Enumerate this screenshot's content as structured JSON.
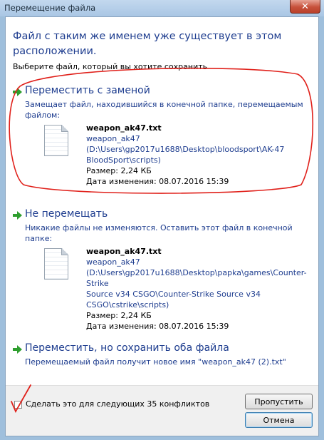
{
  "window": {
    "title": "Перемещение файла"
  },
  "heading": "Файл с таким же именем уже существует в этом расположении.",
  "subtitle": "Выберите файл, который вы хотите сохранить",
  "options": [
    {
      "title": "Переместить с заменой",
      "description": "Замещает файл, находившийся в конечной папке, перемещаемым файлом:",
      "file": {
        "name": "weapon_ak47.txt",
        "path_lines": [
          "weapon_ak47",
          "(D:\\Users\\gp2017u1688\\Desktop\\bloodsport\\AK-47",
          "BloodSport\\scripts)"
        ],
        "size": "Размер: 2,24 КБ",
        "modified": "Дата изменения: 08.07.2016 15:39"
      }
    },
    {
      "title": "Не перемещать",
      "description": "Никакие файлы не изменяются. Оставить этот файл в конечной папке:",
      "file": {
        "name": "weapon_ak47.txt",
        "path_lines": [
          "weapon_ak47",
          "(D:\\Users\\gp2017u1688\\Desktop\\papka\\games\\Counter-Strike",
          "Source v34 CSGO\\Counter-Strike Source v34",
          "CSGO\\cstrike\\scripts)"
        ],
        "size": "Размер: 2,24 КБ",
        "modified": "Дата изменения: 08.07.2016 15:39"
      }
    },
    {
      "title": "Переместить, но сохранить оба файла",
      "description": "Перемещаемый файл получит новое имя \"weapon_ak47 (2).txt\""
    }
  ],
  "checkbox": {
    "label": "Сделать это для следующих 35 конфликтов",
    "checked": false
  },
  "buttons": {
    "skip": "Пропустить",
    "cancel": "Отмена"
  },
  "icons": {
    "option_arrow": "green-arrow-icon",
    "close": "close-icon",
    "file": "text-file-icon"
  },
  "colors": {
    "link_blue": "#1e3d8f",
    "arrow_green": "#2e9e2e",
    "annotation_red": "#e0201a"
  }
}
